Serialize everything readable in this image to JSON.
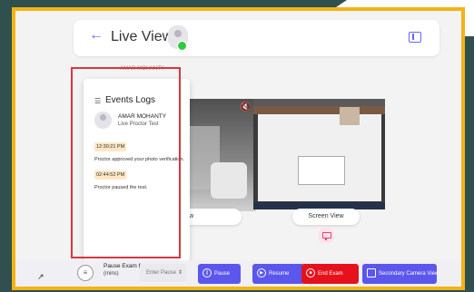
{
  "header": {
    "title": "Live View"
  },
  "behind_card_name": "AMAR MOHANTY",
  "events": {
    "title": "Events Logs",
    "candidate_name": "AMAR MOHANTY",
    "test_name": "Live Proctor Test",
    "entries": [
      {
        "time": "12:30:21 PM",
        "text": "Proctor approved your photo verification."
      },
      {
        "time": "02:44:52 PM",
        "text": "Proctor paused the test."
      }
    ]
  },
  "video": {
    "left_label": "View",
    "right_label": "Screen View"
  },
  "controls": {
    "pause_label": "Pause Exam for:",
    "pause_unit": "(mins)",
    "pause_placeholder": "Enter Pause Time",
    "pause_button": "Pause",
    "resume_button": "Resume",
    "end_button": "End Exam",
    "secondary_button": "Secondary Camera View"
  },
  "colors": {
    "frame": "#f3b316",
    "primary": "#5b56ec",
    "danger": "#e5121e",
    "online": "#2ecc40"
  }
}
